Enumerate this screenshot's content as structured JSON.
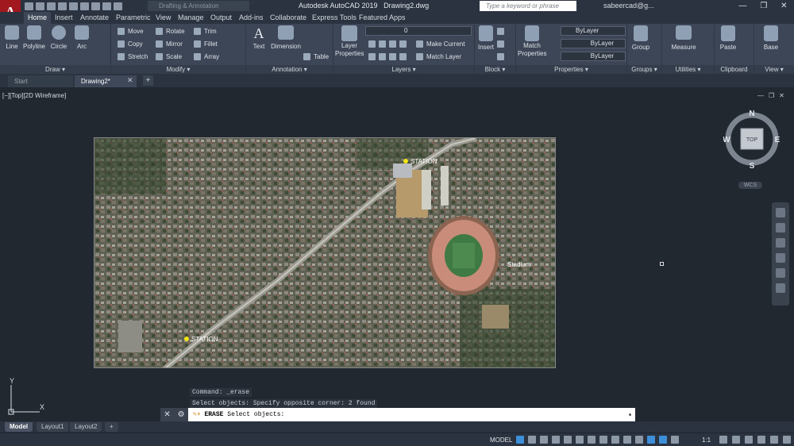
{
  "app": {
    "title": "Autodesk AutoCAD 2019",
    "file": "Drawing2.dwg",
    "logo_letter": "A"
  },
  "workspace": "Drafting & Annotation",
  "search": {
    "placeholder": "Type a keyword or phrase"
  },
  "user": "sabeercad@g...",
  "window_controls": [
    "—",
    "❐",
    "✕"
  ],
  "ribbon_tabs": [
    "Home",
    "Insert",
    "Annotate",
    "Parametric",
    "View",
    "Manage",
    "Output",
    "Add-ins",
    "Collaborate",
    "Express Tools",
    "Featured Apps"
  ],
  "panels": {
    "draw": {
      "title": "Draw ▾",
      "line": "Line",
      "polyline": "Polyline",
      "circle": "Circle",
      "arc": "Arc"
    },
    "modify": {
      "title": "Modify ▾",
      "move": "Move",
      "rotate": "Rotate",
      "trim": "Trim",
      "copy": "Copy",
      "mirror": "Mirror",
      "fillet": "Fillet",
      "stretch": "Stretch",
      "scale": "Scale",
      "array": "Array"
    },
    "annotation": {
      "title": "Annotation ▾",
      "text": "Text",
      "dimension": "Dimension",
      "table": "Table"
    },
    "layers": {
      "title": "Layers ▾",
      "layer_properties": "Layer Properties",
      "current_layer": "0",
      "make_current": "Make Current",
      "match_layer": "Match Layer"
    },
    "block": {
      "title": "Block ▾",
      "insert": "Insert"
    },
    "properties": {
      "title": "Properties ▾",
      "match_properties": "Match Properties",
      "color": "ByLayer",
      "linetype": "ByLayer",
      "lineweight": "ByLayer"
    },
    "groups": {
      "title": "Groups ▾",
      "group": "Group"
    },
    "utilities": {
      "title": "Utilities ▾",
      "measure": "Measure"
    },
    "clipboard": {
      "title": "Clipboard",
      "paste": "Paste"
    },
    "view": {
      "title": "View ▾",
      "base": "Base"
    }
  },
  "doc_tabs": [
    "Start",
    "Drawing2*"
  ],
  "viewport": {
    "label": "[−][Top][2D Wireframe]"
  },
  "viewcube": {
    "n": "N",
    "s": "S",
    "e": "E",
    "w": "W",
    "face": "TOP",
    "wcs": "WCS"
  },
  "map_labels": {
    "station_top": "STATION",
    "station_bottom": "STATION",
    "stadium": "Stadium"
  },
  "ucs": {
    "x": "X",
    "y": "Y"
  },
  "command": {
    "history": [
      "Command: _erase",
      "Select objects: Specify opposite corner: 2 found"
    ],
    "keyword": "ERASE",
    "prompt": "Select objects:"
  },
  "layout_tabs": [
    "Model",
    "Layout1",
    "Layout2",
    "+"
  ],
  "status": {
    "model": "MODEL",
    "scale": "1:1"
  }
}
